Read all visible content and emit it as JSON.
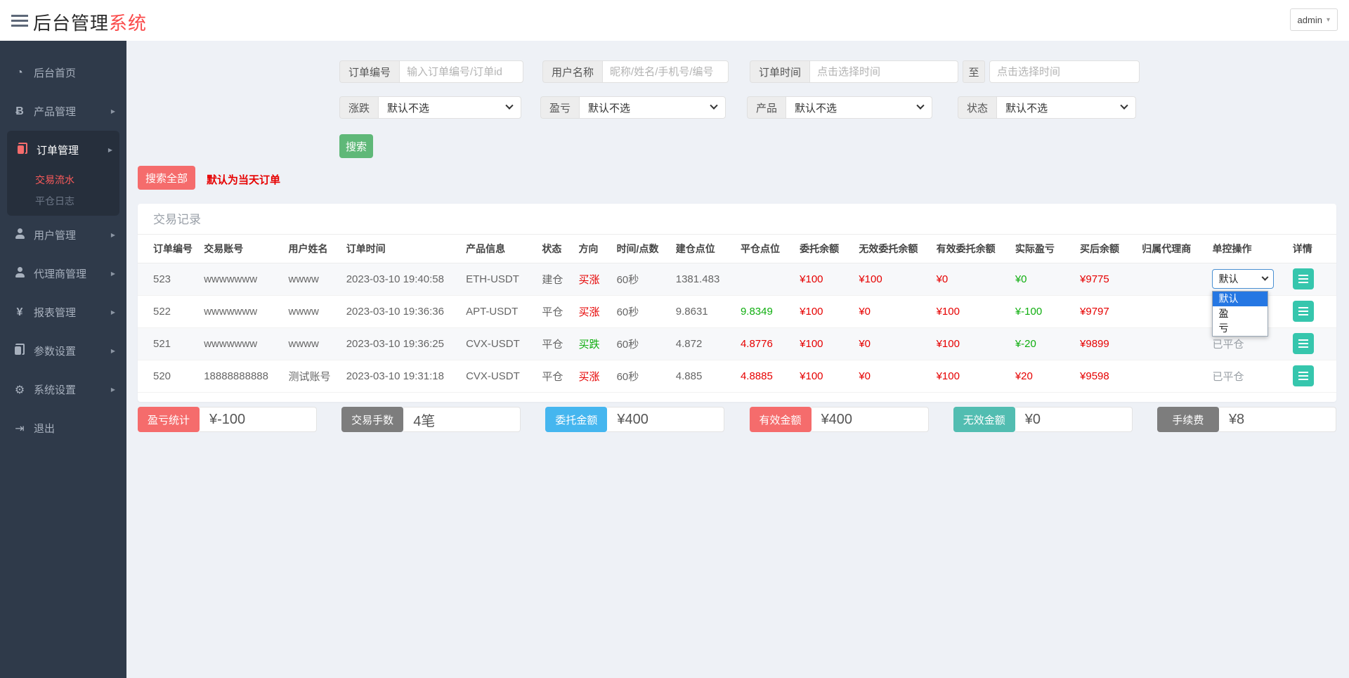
{
  "colors": {
    "accent_red": "#f56c6c",
    "brand_red": "#fa4a4a",
    "text_red": "#e60000",
    "text_green": "#0fae0f",
    "green_button": "#5FB878",
    "blue_stat": "#45b6ef",
    "teal_stat": "#52bdb1",
    "gray_stat": "#7d7d7d",
    "teal_detail_button": "#36c6ad",
    "sidebar_bg": "#2f3a4a",
    "dropdown_highlight": "#2577e3"
  },
  "header": {
    "brand_black": "后台管理",
    "brand_accent": "系统",
    "user": "admin"
  },
  "sidebar": {
    "items": [
      {
        "label": "后台首页",
        "icon": "dashboard-icon"
      },
      {
        "label": "产品管理",
        "icon": "bitcoin-icon",
        "has_children": true
      },
      {
        "label": "订单管理",
        "icon": "orders-icon",
        "has_children": true,
        "active": true,
        "children": [
          {
            "label": "交易流水",
            "active": true
          },
          {
            "label": "平仓日志"
          }
        ]
      },
      {
        "label": "用户管理",
        "icon": "user-icon",
        "has_children": true
      },
      {
        "label": "代理商管理",
        "icon": "agents-icon",
        "has_children": true
      },
      {
        "label": "报表管理",
        "icon": "reports-icon",
        "has_children": true
      },
      {
        "label": "参数设置",
        "icon": "params-icon",
        "has_children": true
      },
      {
        "label": "系统设置",
        "icon": "settings-icon",
        "has_children": true
      },
      {
        "label": "退出",
        "icon": "logout-icon"
      }
    ]
  },
  "filters": {
    "order_no": {
      "label": "订单编号",
      "placeholder": "输入订单编号/订单id",
      "value": ""
    },
    "user_name": {
      "label": "用户名称",
      "placeholder": "昵称/姓名/手机号/编号",
      "value": ""
    },
    "order_time": {
      "label": "订单时间",
      "placeholder": "点击选择时间",
      "to_label": "至",
      "end_placeholder": "点击选择时间",
      "start_value": "",
      "end_value": ""
    },
    "rise_fall": {
      "label": "涨跌",
      "value": "默认不选"
    },
    "profit_loss": {
      "label": "盈亏",
      "value": "默认不选"
    },
    "product": {
      "label": "产品",
      "value": "默认不选"
    },
    "status": {
      "label": "状态",
      "value": "默认不选"
    }
  },
  "actions": {
    "search": "搜索",
    "search_all": "搜索全部",
    "note": "默认为当天订单"
  },
  "table": {
    "title": "交易记录",
    "columns": [
      "订单编号",
      "交易账号",
      "用户姓名",
      "订单时间",
      "产品信息",
      "状态",
      "方向",
      "时间/点数",
      "建仓点位",
      "平仓点位",
      "委托余额",
      "无效委托余额",
      "有效委托余额",
      "实际盈亏",
      "买后余额",
      "归属代理商",
      "单控操作",
      "详情"
    ],
    "control_dropdown": {
      "selected": "默认",
      "options": [
        "默认",
        "盈",
        "亏"
      ],
      "highlighted": "默认"
    },
    "rows": [
      {
        "id": "523",
        "account": "wwwwwww",
        "name": "wwww",
        "time": "2023-03-10 19:40:58",
        "product": "ETH-USDT",
        "status": "建仓",
        "direction": "买涨",
        "direction_color": "red",
        "duration": "60秒",
        "open": "1381.483",
        "close": "",
        "close_color": "",
        "entrust": "¥100",
        "invalid": "¥100",
        "valid": "¥0",
        "profit": "¥0",
        "profit_color": "green",
        "balance": "¥9775",
        "agent": "",
        "control": ""
      },
      {
        "id": "522",
        "account": "wwwwwww",
        "name": "wwww",
        "time": "2023-03-10 19:36:36",
        "product": "APT-USDT",
        "status": "平仓",
        "direction": "买涨",
        "direction_color": "red",
        "duration": "60秒",
        "open": "9.8631",
        "close": "9.8349",
        "close_color": "green",
        "entrust": "¥100",
        "invalid": "¥0",
        "valid": "¥100",
        "profit": "¥-100",
        "profit_color": "green",
        "balance": "¥9797",
        "agent": "",
        "control": ""
      },
      {
        "id": "521",
        "account": "wwwwwww",
        "name": "wwww",
        "time": "2023-03-10 19:36:25",
        "product": "CVX-USDT",
        "status": "平仓",
        "direction": "买跌",
        "direction_color": "green",
        "duration": "60秒",
        "open": "4.872",
        "close": "4.8776",
        "close_color": "red",
        "entrust": "¥100",
        "invalid": "¥0",
        "valid": "¥100",
        "profit": "¥-20",
        "profit_color": "green",
        "balance": "¥9899",
        "agent": "",
        "control": "已平仓"
      },
      {
        "id": "520",
        "account": "18888888888",
        "name": "测试账号",
        "time": "2023-03-10 19:31:18",
        "product": "CVX-USDT",
        "status": "平仓",
        "direction": "买涨",
        "direction_color": "red",
        "duration": "60秒",
        "open": "4.885",
        "close": "4.8885",
        "close_color": "red",
        "entrust": "¥100",
        "invalid": "¥0",
        "valid": "¥100",
        "profit": "¥20",
        "profit_color": "red",
        "balance": "¥9598",
        "agent": "",
        "control": "已平仓"
      }
    ]
  },
  "stats": {
    "items": [
      {
        "label": "盈亏统计",
        "value": "¥-100"
      },
      {
        "label": "交易手数",
        "value": "4笔"
      },
      {
        "label": "委托金额",
        "value": "¥400"
      },
      {
        "label": "有效金额",
        "value": "¥400"
      },
      {
        "label": "无效金额",
        "value": "¥0"
      },
      {
        "label": "手续费",
        "value": "¥8"
      }
    ]
  }
}
